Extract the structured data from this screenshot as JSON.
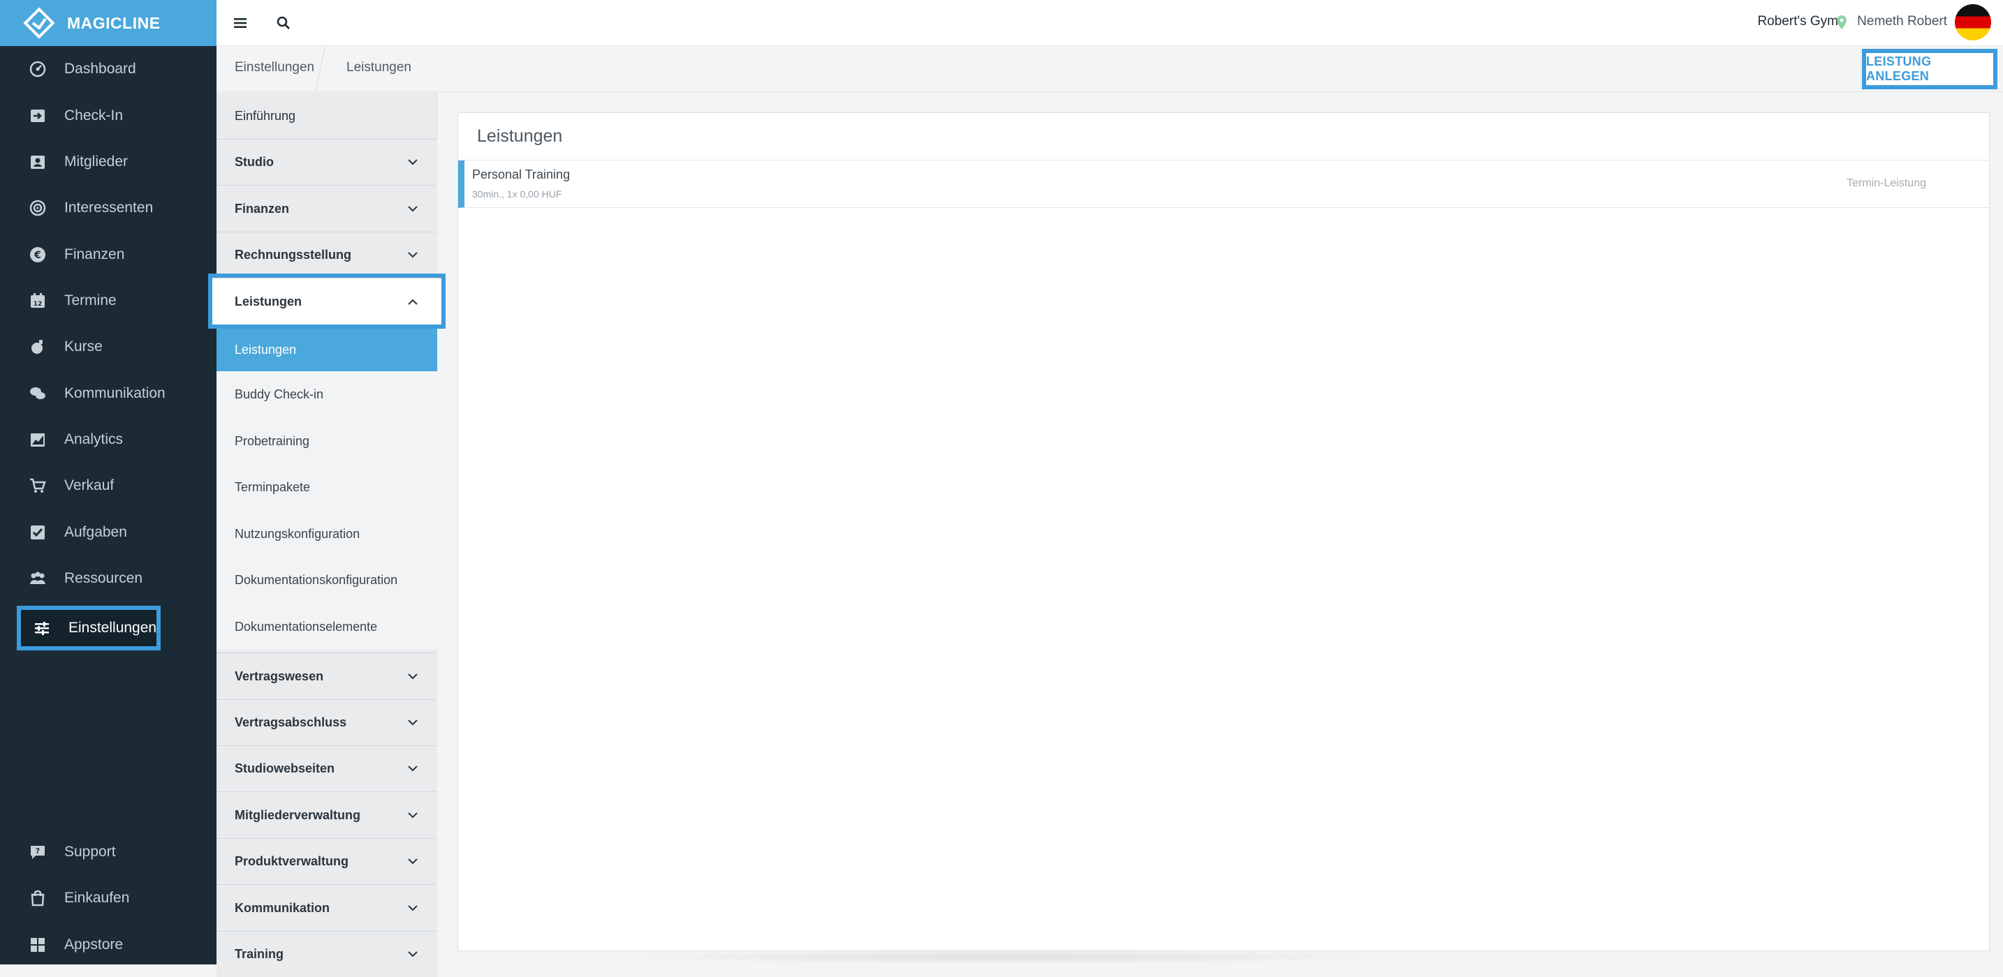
{
  "brand": {
    "name": "MAGICLINE",
    "accent": "#4aa8dc",
    "nav_bg": "#1b2a35",
    "highlight": "#3d9cdb"
  },
  "nav": {
    "items": [
      {
        "label": "Dashboard",
        "icon": "dashboard-icon"
      },
      {
        "label": "Check-In",
        "icon": "check-in-icon"
      },
      {
        "label": "Mitglieder",
        "icon": "members-icon"
      },
      {
        "label": "Interessenten",
        "icon": "prospects-icon"
      },
      {
        "label": "Finanzen",
        "icon": "finance-icon"
      },
      {
        "label": "Termine",
        "icon": "calendar-icon"
      },
      {
        "label": "Kurse",
        "icon": "courses-icon"
      },
      {
        "label": "Kommunikation",
        "icon": "chat-icon"
      },
      {
        "label": "Analytics",
        "icon": "analytics-icon"
      },
      {
        "label": "Verkauf",
        "icon": "cart-icon"
      },
      {
        "label": "Aufgaben",
        "icon": "tasks-icon"
      },
      {
        "label": "Ressourcen",
        "icon": "resources-icon"
      },
      {
        "label": "Einstellungen",
        "icon": "settings-sliders-icon"
      }
    ],
    "bottom": [
      {
        "label": "Support",
        "icon": "support-icon"
      },
      {
        "label": "Einkaufen",
        "icon": "shop-icon"
      },
      {
        "label": "Appstore",
        "icon": "appstore-icon"
      }
    ]
  },
  "topbar": {
    "gym": "Robert's Gym",
    "user": "Nemeth Robert",
    "language_flag": "german-flag"
  },
  "breadcrumb": {
    "items": [
      "Einstellungen",
      "Leistungen"
    ],
    "action_label": "LEISTUNG ANLEGEN"
  },
  "submenu": {
    "intro": "Einführung",
    "sections_before": [
      "Studio",
      "Finanzen",
      "Rechnungsstellung"
    ],
    "open_section": "Leistungen",
    "children": [
      "Leistungen",
      "Buddy Check-in",
      "Probetraining",
      "Terminpakete",
      "Nutzungskonfiguration",
      "Dokumentationskonfiguration",
      "Dokumentationselemente"
    ],
    "sections_after": [
      "Vertragswesen",
      "Vertragsabschluss",
      "Studiowebseiten",
      "Mitgliederverwaltung",
      "Produktverwaltung",
      "Kommunikation",
      "Training"
    ]
  },
  "main": {
    "title": "Leistungen",
    "rows": [
      {
        "title": "Personal Training",
        "subtitle": "30min., 1x 0,00 HUF",
        "type": "Termin-Leistung"
      }
    ]
  }
}
